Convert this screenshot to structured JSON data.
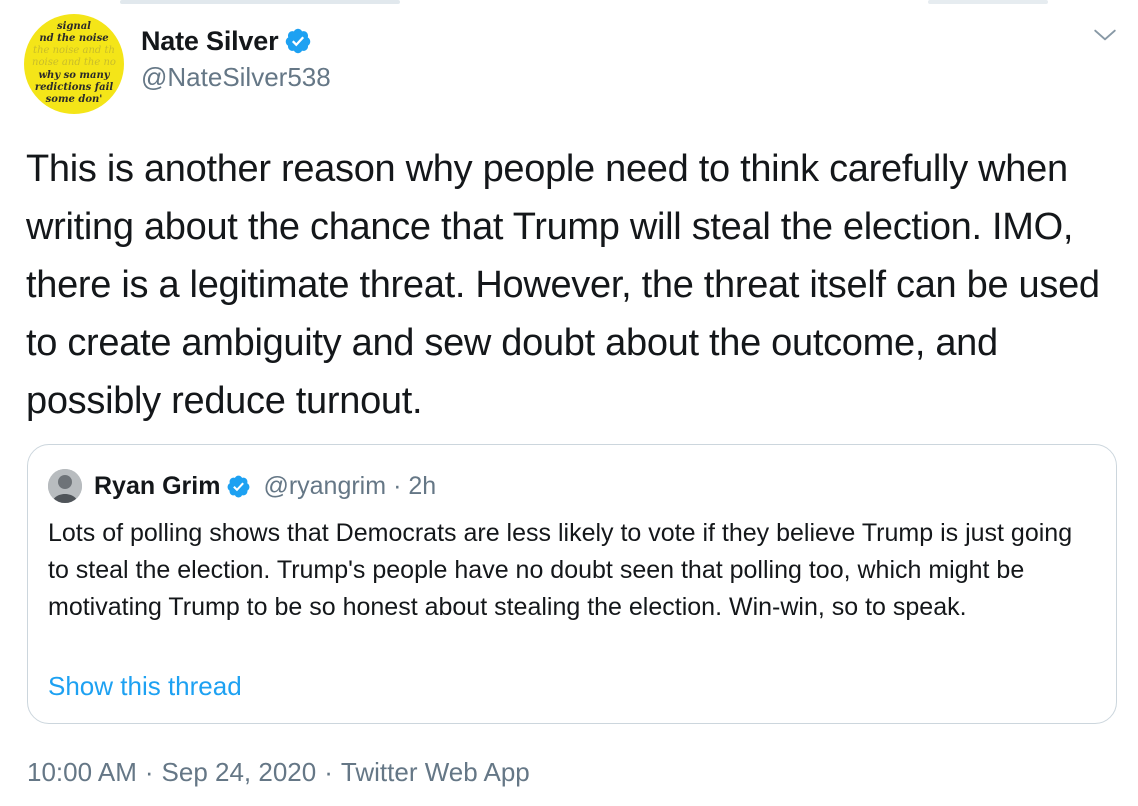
{
  "author": {
    "name": "Nate Silver",
    "handle": "@NateSilver538",
    "avatar_lines": [
      "signal",
      "nd the noise",
      "the noise and th",
      "noise and the no",
      "why so many",
      "redictions fail",
      "some don'"
    ]
  },
  "tweet": {
    "text": "This is another reason why people need to think carefully when writing about the chance that Trump will steal the election. IMO, there is a legitimate threat. However, the threat itself can be used to create ambiguity and sew doubt about the outcome, and possibly reduce turnout."
  },
  "quoted_tweet": {
    "name": "Ryan Grim",
    "handle": "@ryangrim",
    "separator": "·",
    "time": "2h",
    "text": "Lots of polling shows that Democrats are less likely to vote if they believe Trump is just going to steal the election. Trump's people have no doubt seen that polling too, which might be motivating Trump to be so honest about stealing the election. Win-win, so to speak.",
    "show_thread": "Show this thread"
  },
  "footer": {
    "time": "10:00 AM",
    "separator": "·",
    "date": "Sep 24, 2020",
    "source": "Twitter Web App"
  },
  "icons": {
    "verified": "verified-badge-icon",
    "menu": "chevron-down-icon"
  },
  "colors": {
    "text": "#14171a",
    "secondary": "#657786",
    "accent": "#1da1f2",
    "avatar_bg": "#f4e518",
    "border": "#ccd6dd"
  }
}
